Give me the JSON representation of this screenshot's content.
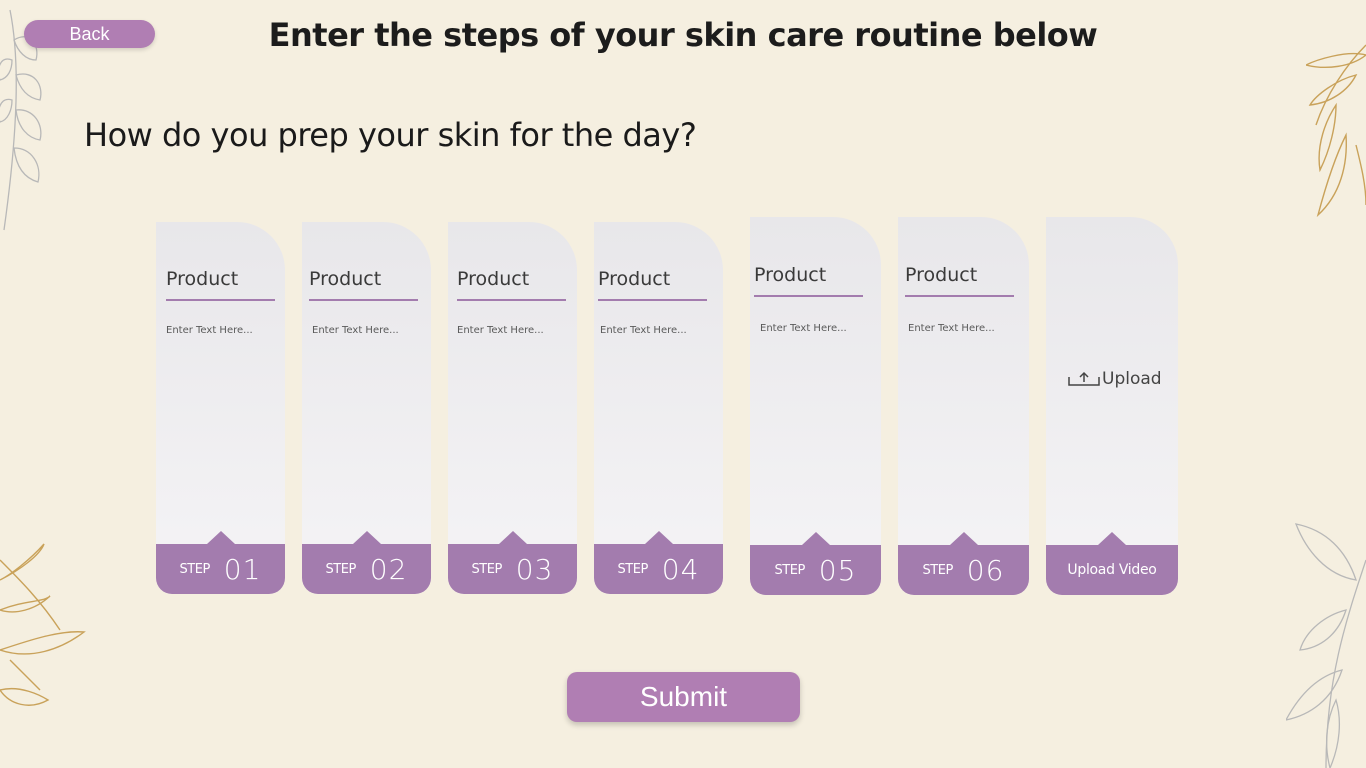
{
  "header": {
    "back_label": "Back",
    "title": "Enter the steps of your skin care routine below"
  },
  "question": "How do you prep your skin for the day?",
  "steps": [
    {
      "product_label": "Product",
      "placeholder": "Enter Text Here...",
      "step_word": "STEP",
      "number": "01"
    },
    {
      "product_label": "Product",
      "placeholder": "Enter Text Here...",
      "step_word": "STEP",
      "number": "02"
    },
    {
      "product_label": "Product",
      "placeholder": "Enter Text Here...",
      "step_word": "STEP",
      "number": "03"
    },
    {
      "product_label": "Product",
      "placeholder": "Enter Text Here...",
      "step_word": "STEP",
      "number": "04"
    },
    {
      "product_label": "Product",
      "placeholder": "Enter Text Here...",
      "step_word": "STEP",
      "number": "05"
    },
    {
      "product_label": "Product",
      "placeholder": "Enter Text Here...",
      "step_word": "STEP",
      "number": "06"
    }
  ],
  "upload_card": {
    "upload_label": "Upload",
    "icon": "upload-icon",
    "footer_label": "Upload Video"
  },
  "submit_label": "Submit",
  "colors": {
    "background": "#f5efe0",
    "accent": "#a37cae",
    "button": "#b07eb3",
    "gold_leaf": "#c9a25a",
    "grey_leaf": "#b8b8b8"
  }
}
